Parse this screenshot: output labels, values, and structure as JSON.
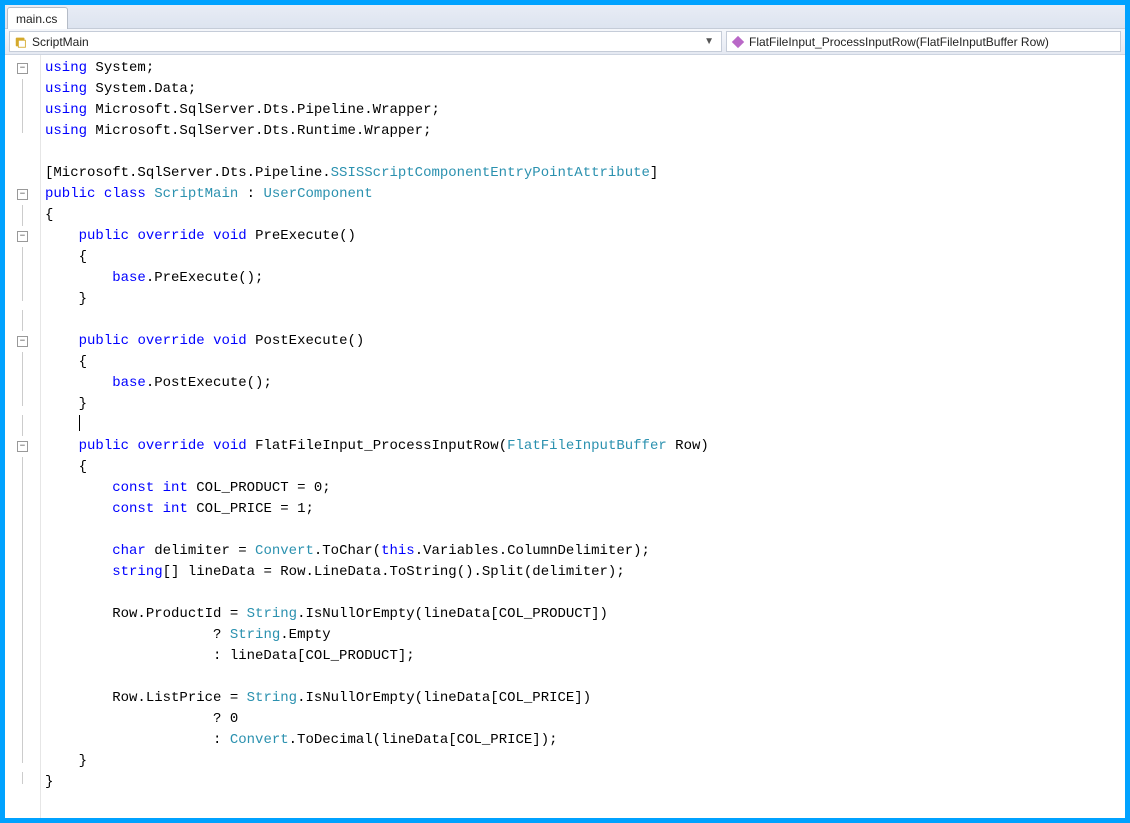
{
  "tab": {
    "title": "main.cs"
  },
  "nav": {
    "class_label": "ScriptMain",
    "member_label": "FlatFileInput_ProcessInputRow(FlatFileInputBuffer Row)"
  },
  "code": {
    "lines": [
      {
        "g": "box-",
        "ind": 0,
        "tok": [
          [
            "kw",
            "using"
          ],
          [
            "",
            " System;"
          ]
        ]
      },
      {
        "g": "line",
        "ind": 0,
        "tok": [
          [
            "kw",
            "using"
          ],
          [
            "",
            " System.Data;"
          ]
        ]
      },
      {
        "g": "line",
        "ind": 0,
        "tok": [
          [
            "kw",
            "using"
          ],
          [
            "",
            " Microsoft.SqlServer.Dts.Pipeline.Wrapper;"
          ]
        ]
      },
      {
        "g": "end",
        "ind": 0,
        "tok": [
          [
            "kw",
            "using"
          ],
          [
            "",
            " Microsoft.SqlServer.Dts.Runtime.Wrapper;"
          ]
        ]
      },
      {
        "g": "",
        "ind": 0,
        "tok": [
          [
            "",
            ""
          ]
        ]
      },
      {
        "g": "",
        "ind": 0,
        "tok": [
          [
            "",
            "["
          ],
          [
            "",
            "Microsoft.SqlServer.Dts.Pipeline."
          ],
          [
            "type",
            "SSISScriptComponentEntryPointAttribute"
          ],
          [
            "",
            "]"
          ]
        ]
      },
      {
        "g": "box-",
        "ind": 0,
        "tok": [
          [
            "kw",
            "public"
          ],
          [
            "",
            " "
          ],
          [
            "kw",
            "class"
          ],
          [
            "",
            " "
          ],
          [
            "type",
            "ScriptMain"
          ],
          [
            "",
            " : "
          ],
          [
            "type",
            "UserComponent"
          ]
        ]
      },
      {
        "g": "line",
        "ind": 0,
        "tok": [
          [
            "",
            "{"
          ]
        ]
      },
      {
        "g": "box-",
        "ind": 1,
        "tok": [
          [
            "kw",
            "public"
          ],
          [
            "",
            " "
          ],
          [
            "kw",
            "override"
          ],
          [
            "",
            " "
          ],
          [
            "kw",
            "void"
          ],
          [
            "",
            " PreExecute()"
          ]
        ]
      },
      {
        "g": "line",
        "ind": 1,
        "tok": [
          [
            "",
            "{"
          ]
        ]
      },
      {
        "g": "line",
        "ind": 2,
        "tok": [
          [
            "kw",
            "base"
          ],
          [
            "",
            ".PreExecute();"
          ]
        ]
      },
      {
        "g": "end",
        "ind": 1,
        "tok": [
          [
            "",
            "}"
          ]
        ]
      },
      {
        "g": "line",
        "ind": 0,
        "tok": [
          [
            "",
            ""
          ]
        ]
      },
      {
        "g": "box-",
        "ind": 1,
        "tok": [
          [
            "kw",
            "public"
          ],
          [
            "",
            " "
          ],
          [
            "kw",
            "override"
          ],
          [
            "",
            " "
          ],
          [
            "kw",
            "void"
          ],
          [
            "",
            " PostExecute()"
          ]
        ]
      },
      {
        "g": "line",
        "ind": 1,
        "tok": [
          [
            "",
            "{"
          ]
        ]
      },
      {
        "g": "line",
        "ind": 2,
        "tok": [
          [
            "kw",
            "base"
          ],
          [
            "",
            ".PostExecute();"
          ]
        ]
      },
      {
        "g": "end",
        "ind": 1,
        "tok": [
          [
            "",
            "}"
          ]
        ]
      },
      {
        "g": "line",
        "ind": 1,
        "caret": true,
        "tok": [
          [
            "",
            ""
          ]
        ]
      },
      {
        "g": "box-",
        "ind": 1,
        "tok": [
          [
            "kw",
            "public"
          ],
          [
            "",
            " "
          ],
          [
            "kw",
            "override"
          ],
          [
            "",
            " "
          ],
          [
            "kw",
            "void"
          ],
          [
            "",
            " FlatFileInput_ProcessInputRow("
          ],
          [
            "type",
            "FlatFileInputBuffer"
          ],
          [
            "",
            " Row)"
          ]
        ]
      },
      {
        "g": "line",
        "ind": 1,
        "tok": [
          [
            "",
            "{"
          ]
        ]
      },
      {
        "g": "line",
        "ind": 2,
        "tok": [
          [
            "kw",
            "const"
          ],
          [
            "",
            " "
          ],
          [
            "kw",
            "int"
          ],
          [
            "",
            " COL_PRODUCT = 0;"
          ]
        ]
      },
      {
        "g": "line",
        "ind": 2,
        "tok": [
          [
            "kw",
            "const"
          ],
          [
            "",
            " "
          ],
          [
            "kw",
            "int"
          ],
          [
            "",
            " COL_PRICE = 1;"
          ]
        ]
      },
      {
        "g": "line",
        "ind": 0,
        "tok": [
          [
            "",
            ""
          ]
        ]
      },
      {
        "g": "line",
        "ind": 2,
        "tok": [
          [
            "kw",
            "char"
          ],
          [
            "",
            " delimiter = "
          ],
          [
            "type",
            "Convert"
          ],
          [
            "",
            ".ToChar("
          ],
          [
            "kw",
            "this"
          ],
          [
            "",
            ".Variables.ColumnDelimiter);"
          ]
        ]
      },
      {
        "g": "line",
        "ind": 2,
        "tok": [
          [
            "kw",
            "string"
          ],
          [
            "",
            "[] lineData = Row.LineData.ToString().Split(delimiter);"
          ]
        ]
      },
      {
        "g": "line",
        "ind": 0,
        "tok": [
          [
            "",
            ""
          ]
        ]
      },
      {
        "g": "line",
        "ind": 2,
        "tok": [
          [
            "",
            "Row.ProductId = "
          ],
          [
            "type",
            "String"
          ],
          [
            "",
            ".IsNullOrEmpty(lineData[COL_PRODUCT])"
          ]
        ]
      },
      {
        "g": "line",
        "ind": 5,
        "tok": [
          [
            "",
            "? "
          ],
          [
            "type",
            "String"
          ],
          [
            "",
            ".Empty"
          ]
        ]
      },
      {
        "g": "line",
        "ind": 5,
        "tok": [
          [
            "",
            ": lineData[COL_PRODUCT];"
          ]
        ]
      },
      {
        "g": "line",
        "ind": 0,
        "tok": [
          [
            "",
            ""
          ]
        ]
      },
      {
        "g": "line",
        "ind": 2,
        "tok": [
          [
            "",
            "Row.ListPrice = "
          ],
          [
            "type",
            "String"
          ],
          [
            "",
            ".IsNullOrEmpty(lineData[COL_PRICE])"
          ]
        ]
      },
      {
        "g": "line",
        "ind": 5,
        "tok": [
          [
            "",
            "? 0"
          ]
        ]
      },
      {
        "g": "line",
        "ind": 5,
        "tok": [
          [
            "",
            ": "
          ],
          [
            "type",
            "Convert"
          ],
          [
            "",
            ".ToDecimal(lineData[COL_PRICE]);"
          ]
        ]
      },
      {
        "g": "end",
        "ind": 1,
        "tok": [
          [
            "",
            "}"
          ]
        ]
      },
      {
        "g": "end",
        "ind": 0,
        "tok": [
          [
            "",
            "}"
          ]
        ]
      }
    ]
  }
}
